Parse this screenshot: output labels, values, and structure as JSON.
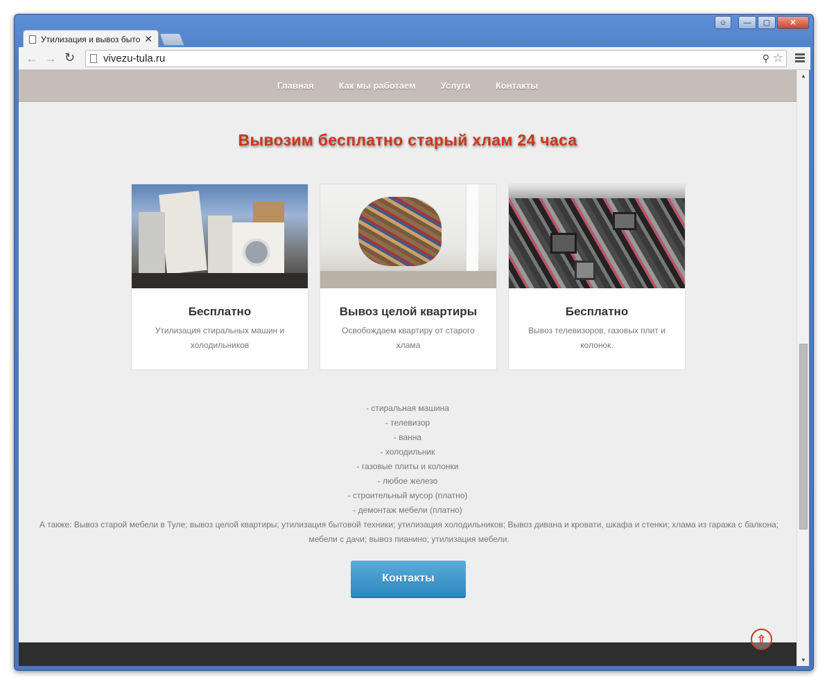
{
  "browser": {
    "tab_title": "Утилизация и вывоз быто",
    "url": "vivezu-tula.ru"
  },
  "nav": {
    "items": [
      "Главная",
      "Как мы работаем",
      "Услуги",
      "Контакты"
    ]
  },
  "headline": "Вывозим бесплатно старый хлам 24 часа",
  "cards": [
    {
      "title": "Бесплатно",
      "text": "Утилизация стиральных машин и холодильников"
    },
    {
      "title": "Вывоз целой квартиры",
      "text": "Освобождаем квартиру от старого хлама"
    },
    {
      "title": "Бесплатно",
      "text": "Вывоз телевизоров, газовых плит и колонок."
    }
  ],
  "list": [
    "- стиральная машина",
    "- телевизор",
    "- ванна",
    "- холодильник",
    "- газовые плиты и колонки",
    "- любое железо",
    "- строительный мусор (платно)",
    "- демонтаж мебели (платно)"
  ],
  "also_text": "А также: Вывоз старой мебели в Туле; вывоз целой квартиры; утилизация бытовой техники; утилизация холодильников; Вывоз дивана и кровати, шкафа и стенки; хлама из гаража с балкона; мебели с дачи; вывоз пианино; утилизация мебели.",
  "contacts_button": "Контакты",
  "colors": {
    "accent_red": "#c8391c",
    "button_blue": "#3a93c9",
    "nav_bg": "#c5bdb8",
    "footer_bg": "#2e2e2e"
  },
  "icons": {
    "back": "arrow-left-icon",
    "forward": "arrow-right-icon",
    "reload": "reload-icon",
    "zoom": "zoom-icon",
    "star": "star-icon",
    "menu": "menu-icon",
    "to_top": "arrow-up-circle-icon"
  }
}
